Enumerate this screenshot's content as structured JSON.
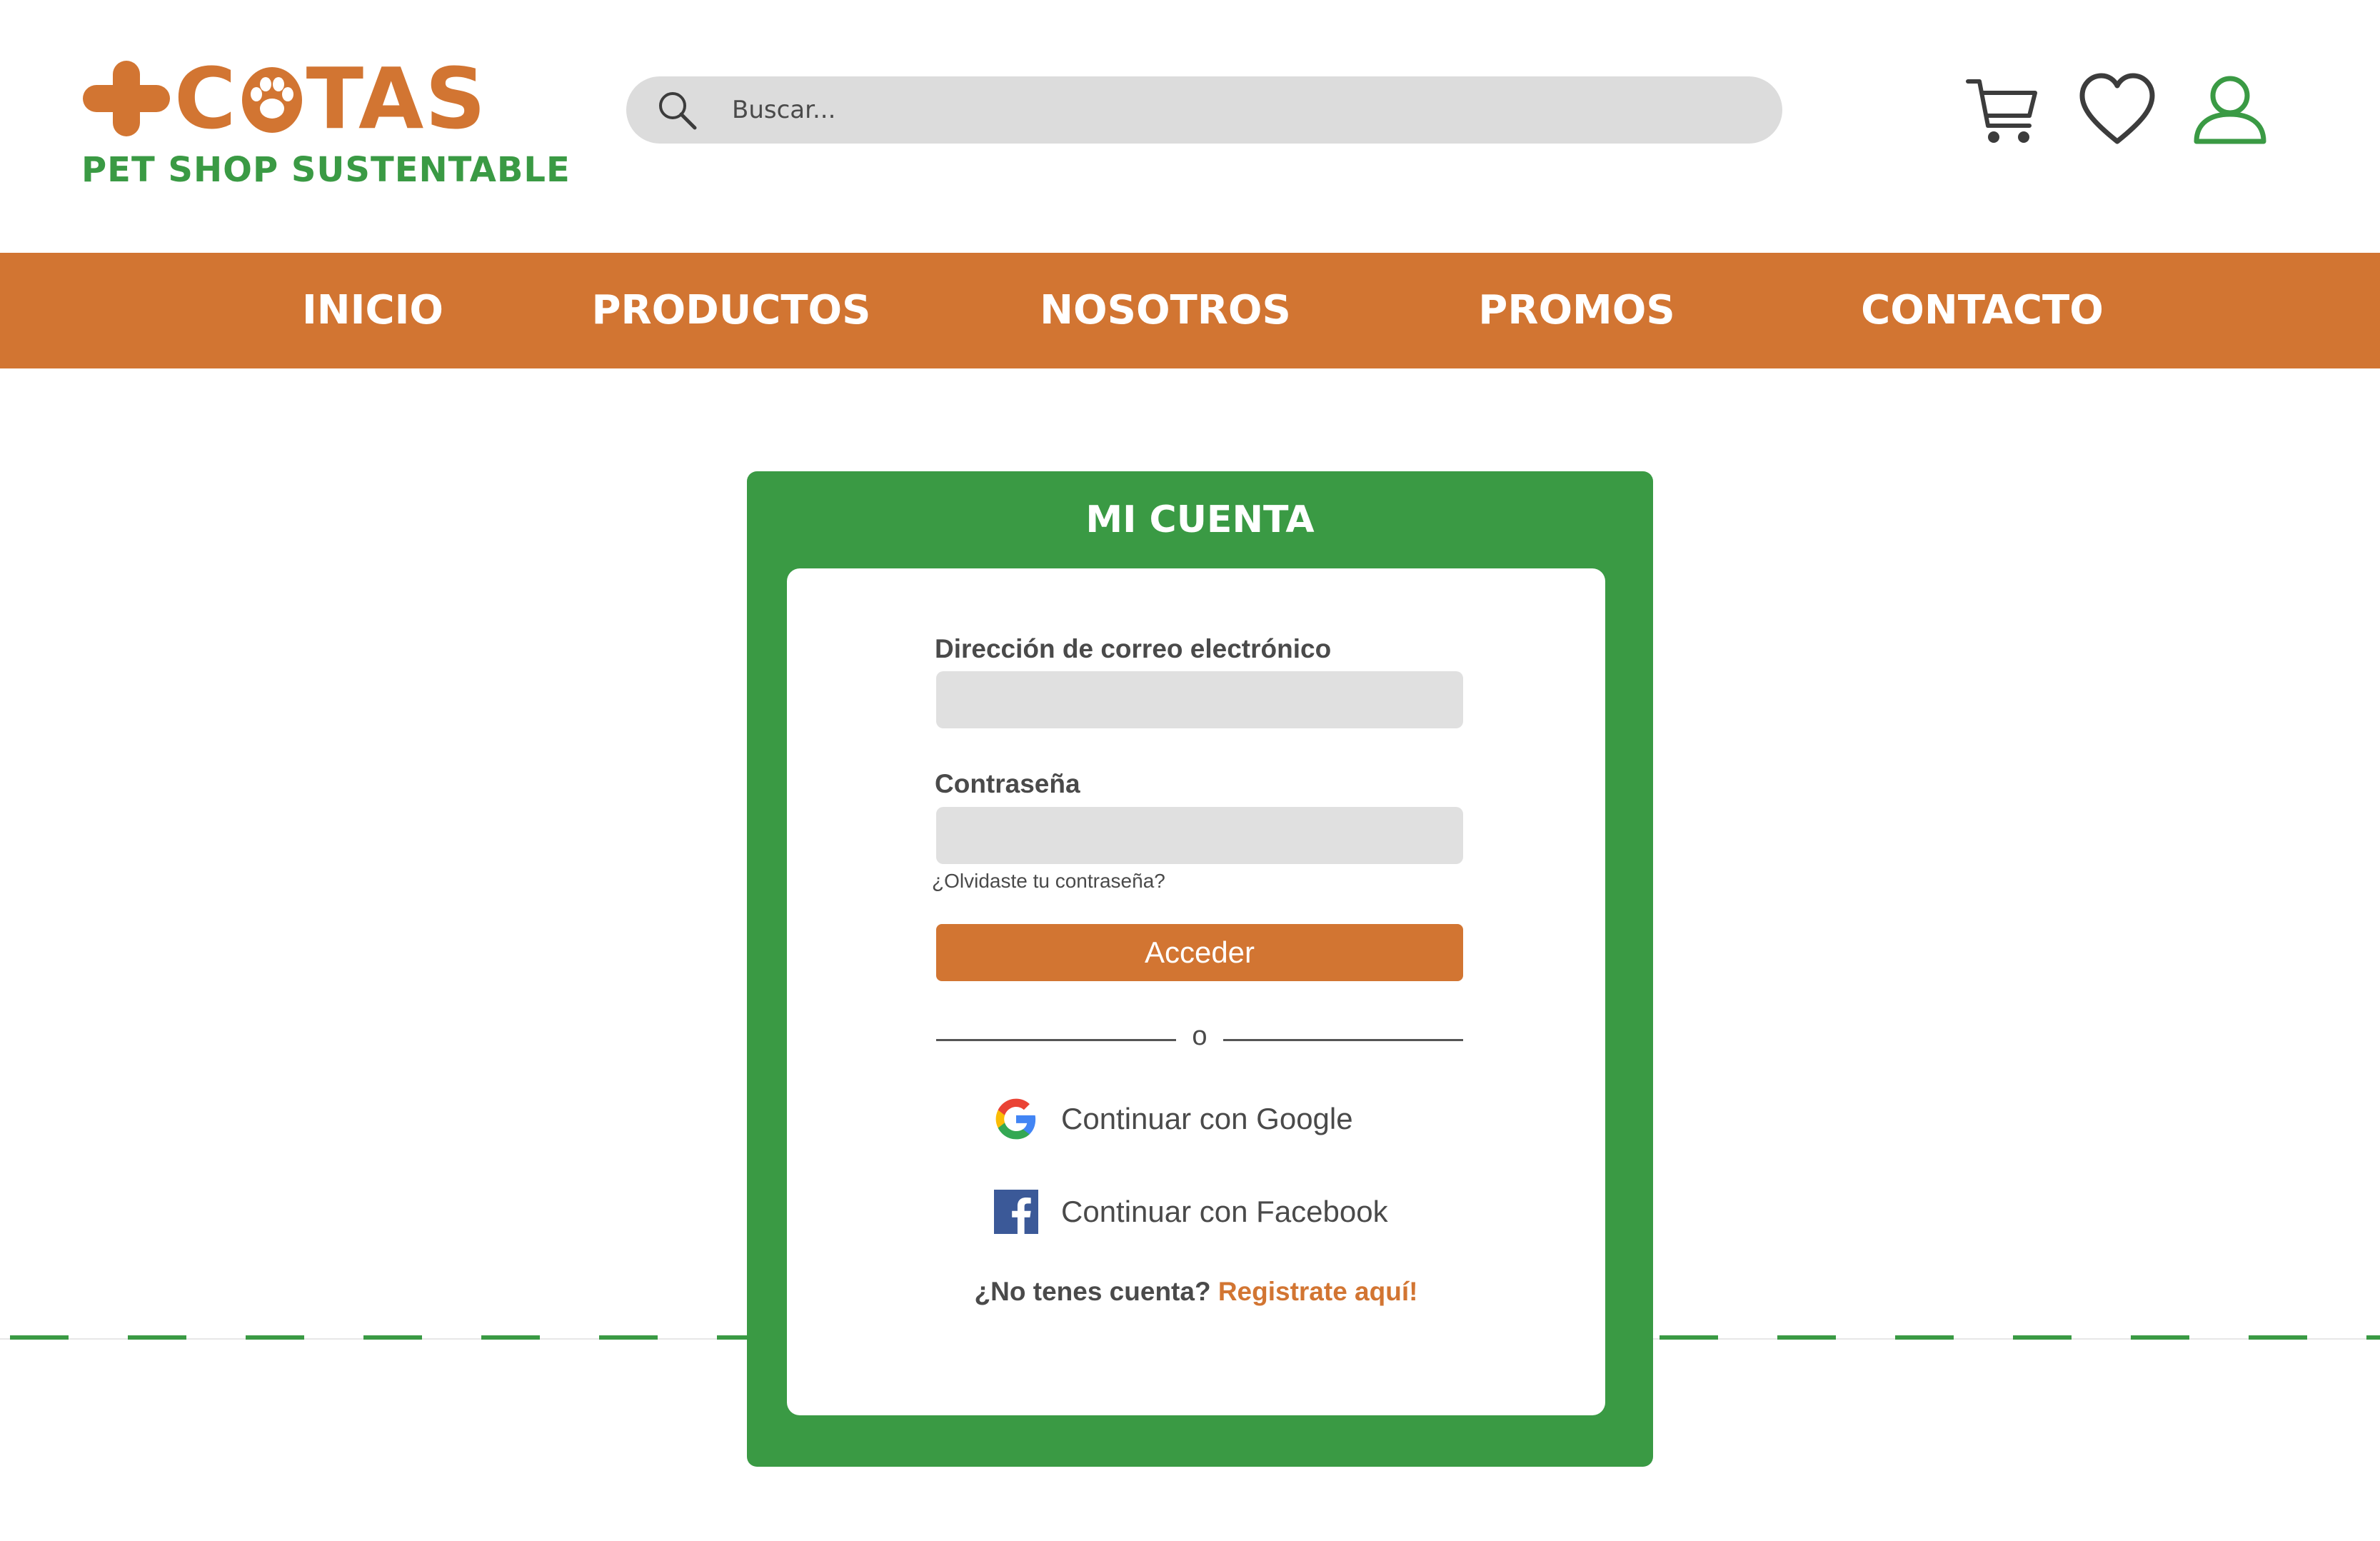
{
  "brand": {
    "name": "COTAS",
    "tagline": "PET SHOP SUSTENTABLE",
    "primary_color": "#d27532",
    "secondary_color": "#3a9a44",
    "logo_icons": [
      "plus-icon",
      "paw-icon"
    ]
  },
  "search": {
    "placeholder": "Buscar...",
    "icon": "search-icon"
  },
  "header_icons": [
    "cart-icon",
    "heart-icon",
    "user-icon"
  ],
  "nav": {
    "items": [
      {
        "label": "INICIO"
      },
      {
        "label": "PRODUCTOS"
      },
      {
        "label": "NOSOTROS"
      },
      {
        "label": "PROMOS"
      },
      {
        "label": "CONTACTO"
      }
    ]
  },
  "login": {
    "title": "MI CUENTA",
    "email_label": "Dirección de correo electrónico",
    "email_value": "",
    "password_label": "Contraseña",
    "password_value": "",
    "forgot_link": "¿Olvidaste tu contraseña?",
    "submit_label": "Acceder",
    "divider_text": "o",
    "google_label": "Continuar con Google",
    "facebook_label": "Continuar con Facebook",
    "register_prompt": "¿No tenes cuenta?",
    "register_link": "Registrate aquí!"
  }
}
